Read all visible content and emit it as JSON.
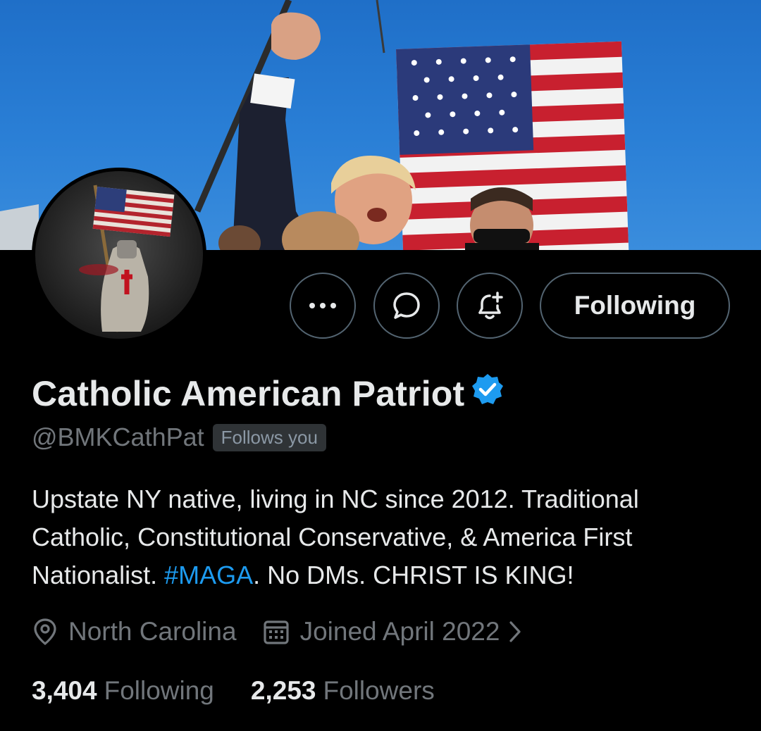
{
  "profile": {
    "display_name": "Catholic American Patriot",
    "handle": "@BMKCathPat",
    "follows_you": "Follows you",
    "bio_part1": "Upstate NY native, living in NC since 2012.  Traditional Catholic, Constitutional Conservative, & America First Nationalist. ",
    "bio_hashtag": "#MAGA",
    "bio_part2": ". No DMs. CHRIST IS KING!",
    "location": "North Carolina",
    "joined": "Joined April 2022",
    "following_count": "3,404",
    "following_label": "Following",
    "followers_count": "2,253",
    "followers_label": "Followers"
  },
  "actions": {
    "more_label": "•••",
    "follow_label": "Following"
  },
  "icons": {
    "more": "more-icon",
    "message": "message-icon",
    "notify": "bell-plus-icon",
    "verified": "verified-badge-icon",
    "location": "location-pin-icon",
    "calendar": "calendar-icon",
    "chevron": "chevron-right-icon"
  },
  "colors": {
    "background": "#000000",
    "text_primary": "#e7e9ea",
    "text_secondary": "#71767b",
    "accent": "#1d9bf0",
    "border": "#536471"
  }
}
